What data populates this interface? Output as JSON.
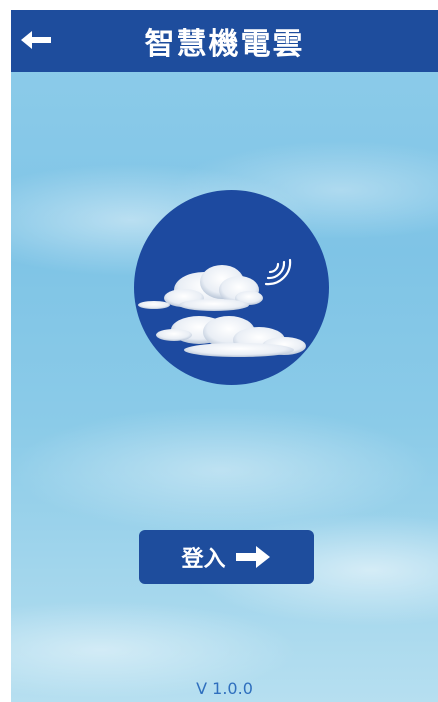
{
  "header": {
    "title": "智慧機電雲",
    "back_icon": "arrow-left-icon"
  },
  "logo": {
    "icon": "cloud-wireless-icon"
  },
  "login": {
    "label": "登入",
    "icon": "arrow-right-icon"
  },
  "footer": {
    "version": "V 1.0.0"
  },
  "colors": {
    "brand": "#1e4d9d",
    "version_text": "#2f6fbe"
  }
}
